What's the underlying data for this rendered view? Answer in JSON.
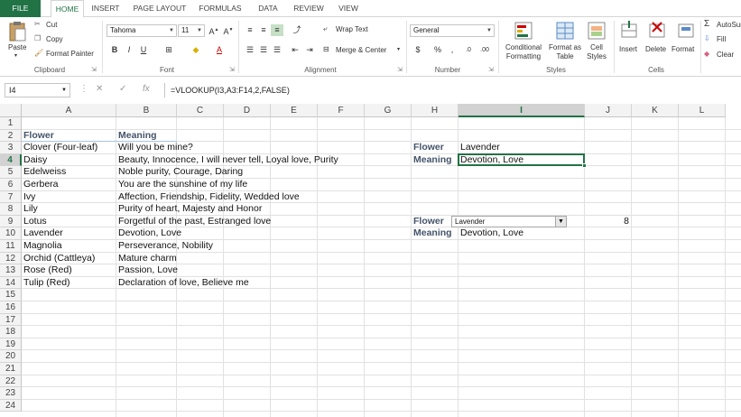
{
  "tabs": [
    "FILE",
    "HOME",
    "INSERT",
    "PAGE LAYOUT",
    "FORMULAS",
    "DATA",
    "REVIEW",
    "VIEW"
  ],
  "ribbon": {
    "clipboard": {
      "paste": "Paste",
      "cut": "Cut",
      "copy": "Copy",
      "format_painter": "Format Painter",
      "label": "Clipboard"
    },
    "font": {
      "name": "Tahoma",
      "size": "11",
      "label": "Font"
    },
    "alignment": {
      "wrap": "Wrap Text",
      "merge": "Merge & Center",
      "label": "Alignment"
    },
    "number": {
      "format": "General",
      "label": "Number"
    },
    "styles": {
      "cond": "Conditional Formatting",
      "table": "Format as Table",
      "cell": "Cell Styles",
      "label": "Styles"
    },
    "cells": {
      "insert": "Insert",
      "delete": "Delete",
      "format": "Format",
      "label": "Cells"
    },
    "editing": {
      "autosum": "AutoSum",
      "fill": "Fill",
      "clear": "Clear"
    }
  },
  "formula_bar": {
    "name_box": "I4",
    "formula": "=VLOOKUP(I3,A3:F14,2,FALSE)"
  },
  "columns": [
    "A",
    "B",
    "C",
    "D",
    "E",
    "F",
    "G",
    "H",
    "I",
    "J",
    "K",
    "L"
  ],
  "rows": [
    "1",
    "2",
    "3",
    "4",
    "5",
    "6",
    "7",
    "8",
    "9",
    "10",
    "11",
    "12",
    "13",
    "14",
    "15",
    "16",
    "17",
    "18",
    "19",
    "20",
    "21",
    "22",
    "23",
    "24"
  ],
  "table": {
    "header_flower": "Flower",
    "header_meaning": "Meaning",
    "rows": [
      {
        "flower": "Clover (Four-leaf)",
        "meaning": "Will you be mine?"
      },
      {
        "flower": "Daisy",
        "meaning": "Beauty, Innocence, I will never tell, Loyal love, Purity"
      },
      {
        "flower": "Edelweiss",
        "meaning": "Noble purity, Courage, Daring"
      },
      {
        "flower": "Gerbera",
        "meaning": "You are the sunshine of my life"
      },
      {
        "flower": "Ivy",
        "meaning": "Affection, Friendship, Fidelity, Wedded love"
      },
      {
        "flower": "Lily",
        "meaning": "Purity of heart, Majesty and Honor"
      },
      {
        "flower": "Lotus",
        "meaning": "Forgetful of the past, Estranged love"
      },
      {
        "flower": "Lavender",
        "meaning": "Devotion, Love"
      },
      {
        "flower": "Magnolia",
        "meaning": "Perseverance, Nobility"
      },
      {
        "flower": "Orchid (Cattleya)",
        "meaning": "Mature charm"
      },
      {
        "flower": "Rose (Red)",
        "meaning": "Passion, Love"
      },
      {
        "flower": "Tulip (Red)",
        "meaning": "Declaration of love, Believe me"
      }
    ]
  },
  "lookup1": {
    "flower_label": "Flower",
    "flower_value": "Lavender",
    "meaning_label": "Meaning",
    "meaning_value": "Devotion, Love"
  },
  "lookup2": {
    "flower_label": "Flower",
    "dropdown_value": "Lavender",
    "index_value": "8",
    "meaning_label": "Meaning",
    "meaning_value": "Devotion, Love"
  },
  "colors": {
    "accent": "#217346",
    "header_text": "#44546a"
  }
}
